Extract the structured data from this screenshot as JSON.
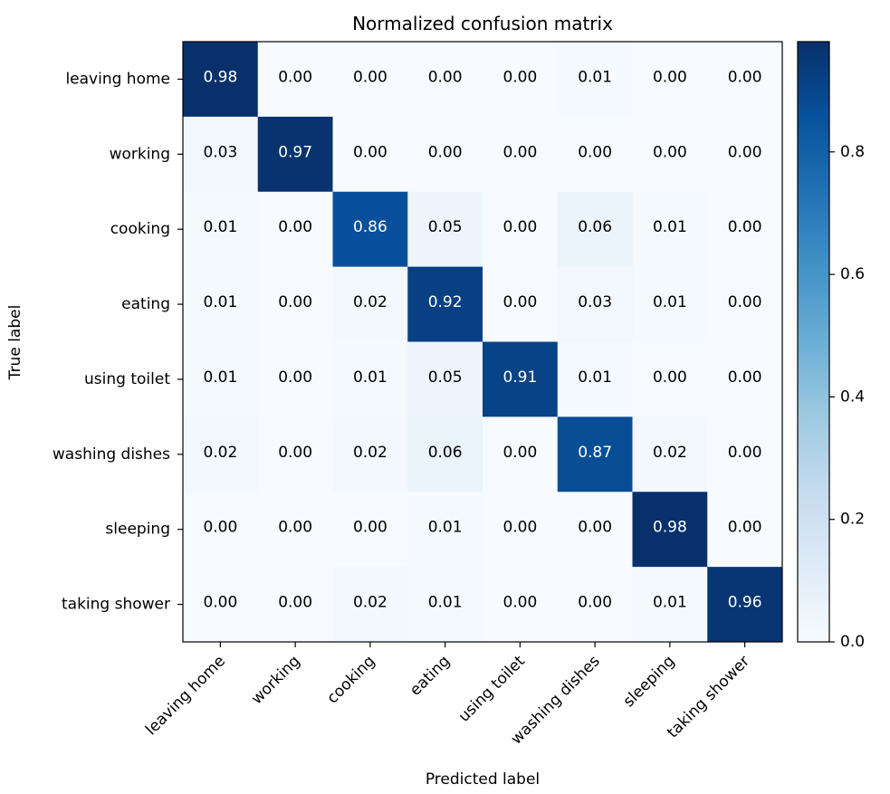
{
  "chart_data": {
    "type": "heatmap",
    "title": "Normalized confusion matrix",
    "xlabel": "Predicted label",
    "ylabel": "True label",
    "x_categories": [
      "leaving home",
      "working",
      "cooking",
      "eating",
      "using toilet",
      "washing dishes",
      "sleeping",
      "taking shower"
    ],
    "y_categories": [
      "leaving home",
      "working",
      "cooking",
      "eating",
      "using toilet",
      "washing dishes",
      "sleeping",
      "taking shower"
    ],
    "values": [
      [
        0.98,
        0.0,
        0.0,
        0.0,
        0.0,
        0.01,
        0.0,
        0.0
      ],
      [
        0.03,
        0.97,
        0.0,
        0.0,
        0.0,
        0.0,
        0.0,
        0.0
      ],
      [
        0.01,
        0.0,
        0.86,
        0.05,
        0.0,
        0.06,
        0.01,
        0.0
      ],
      [
        0.01,
        0.0,
        0.02,
        0.92,
        0.0,
        0.03,
        0.01,
        0.0
      ],
      [
        0.01,
        0.0,
        0.01,
        0.05,
        0.91,
        0.01,
        0.0,
        0.0
      ],
      [
        0.02,
        0.0,
        0.02,
        0.06,
        0.0,
        0.87,
        0.02,
        0.0
      ],
      [
        0.0,
        0.0,
        0.0,
        0.01,
        0.0,
        0.0,
        0.98,
        0.0
      ],
      [
        0.0,
        0.0,
        0.02,
        0.01,
        0.0,
        0.0,
        0.01,
        0.96
      ]
    ],
    "value_format": "0.00",
    "colormap": "Blues",
    "colorbar": {
      "range": [
        0.0,
        0.98
      ],
      "ticks": [
        0.0,
        0.2,
        0.4,
        0.6,
        0.8
      ],
      "tick_labels": [
        "0.0",
        "0.2",
        "0.4",
        "0.6",
        "0.8"
      ],
      "placement": "right"
    },
    "text_threshold": 0.49,
    "text_color_light": "#ffffff",
    "text_color_dark": "#000000",
    "grid": false
  }
}
